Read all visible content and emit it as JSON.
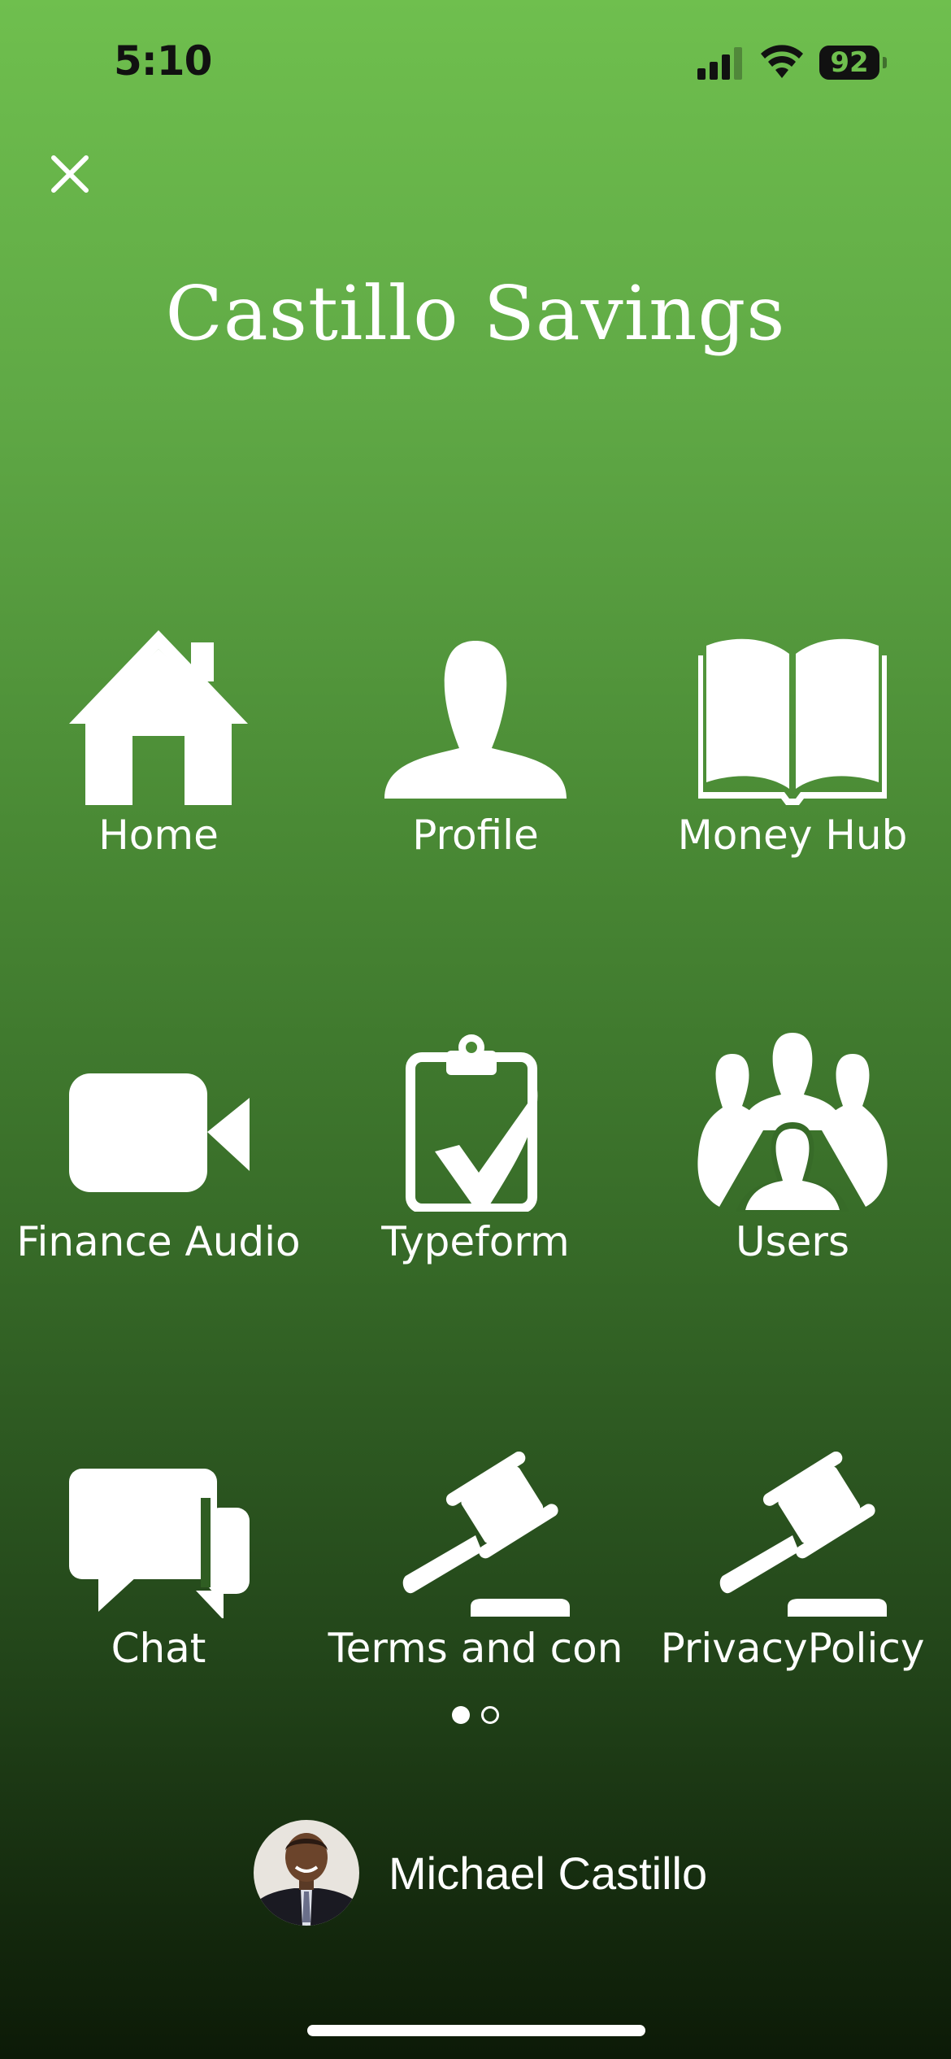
{
  "status_bar": {
    "time": "5:10",
    "battery": "92",
    "icons": [
      "cellular-signal-icon",
      "wifi-icon",
      "battery-icon"
    ]
  },
  "header": {
    "close_icon": "close-icon",
    "title": "Castillo Savings"
  },
  "menu": {
    "items": [
      {
        "label": "Home",
        "icon": "house-icon"
      },
      {
        "label": "Profile",
        "icon": "person-icon"
      },
      {
        "label": "Money Hub",
        "icon": "open-book-icon"
      },
      {
        "label": "Finance Audio",
        "icon": "video-camera-icon"
      },
      {
        "label": "Typeform",
        "icon": "clipboard-check-icon"
      },
      {
        "label": "Users",
        "icon": "group-icon"
      },
      {
        "label": "Chat",
        "icon": "chat-bubbles-icon"
      },
      {
        "label": "Terms and con",
        "icon": "gavel-icon"
      },
      {
        "label": "PrivacyPolicy",
        "icon": "gavel-icon"
      }
    ]
  },
  "pagination": {
    "total_pages": 2,
    "current_page": 1
  },
  "user": {
    "name": "Michael Castillo"
  },
  "colors": {
    "gradient_top": "#6fbf4e",
    "gradient_bottom": "#0c1a07",
    "text": "#ffffff"
  }
}
